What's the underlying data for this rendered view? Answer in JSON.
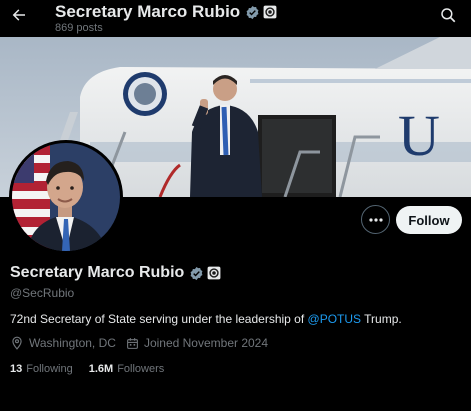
{
  "header": {
    "title": "Secretary Marco Rubio",
    "posts_count": "869 posts"
  },
  "profile": {
    "display_name": "Secretary Marco Rubio",
    "handle": "@SecRubio",
    "bio": {
      "before": "72nd Secretary of State serving under the leadership of ",
      "mention": "@POTUS",
      "after": " Trump."
    },
    "location": "Washington, DC",
    "joined": "Joined November 2024",
    "following_count": "13",
    "following_label": "Following",
    "followers_count": "1.6M",
    "followers_label": "Followers"
  },
  "actions": {
    "follow_label": "Follow"
  },
  "icons": {
    "back": "arrow-left-icon",
    "search": "search-icon",
    "verified": "verified-check-icon",
    "affiliation": "seal-icon",
    "more": "more-dots-icon",
    "location": "location-pin-icon",
    "calendar": "calendar-icon"
  },
  "colors": {
    "background": "#000000",
    "text_primary": "#e7e9ea",
    "text_secondary": "#71767b",
    "link": "#1d9bf0",
    "verified_badge": "#829aab",
    "follow_button_bg": "#eff3f4"
  }
}
